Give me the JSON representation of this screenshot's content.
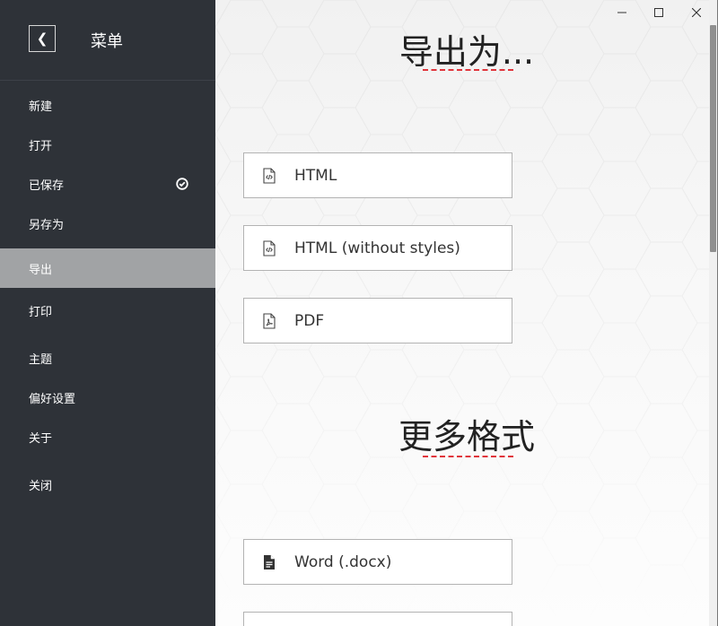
{
  "sidebar": {
    "back_glyph": "❮",
    "title": "菜单",
    "items": [
      {
        "label": "新建"
      },
      {
        "label": "打开"
      },
      {
        "label": "已保存",
        "icon": "check-circle-icon"
      },
      {
        "label": "另存为"
      },
      {
        "label": "导出",
        "active": true
      },
      {
        "label": "打印"
      },
      {
        "label": "主题"
      },
      {
        "label": "偏好设置"
      },
      {
        "label": "关于"
      },
      {
        "label": "关闭"
      }
    ]
  },
  "window": {
    "minimize_glyph": "—",
    "maximize_glyph": "☐",
    "close_glyph": "✕"
  },
  "export": {
    "heading": "导出为...",
    "options": [
      {
        "label": "HTML",
        "icon": "html-file-icon"
      },
      {
        "label": "HTML (without styles)",
        "icon": "html-file-icon"
      },
      {
        "label": "PDF",
        "icon": "pdf-file-icon"
      }
    ]
  },
  "more_formats": {
    "heading": "更多格式",
    "options": [
      {
        "label": "Word (.docx)",
        "icon": "document-icon"
      }
    ]
  },
  "colors": {
    "sidebar_bg": "#2e3238",
    "active_item_bg": "#a1a3a5",
    "accent_underline": "#e0343b"
  }
}
